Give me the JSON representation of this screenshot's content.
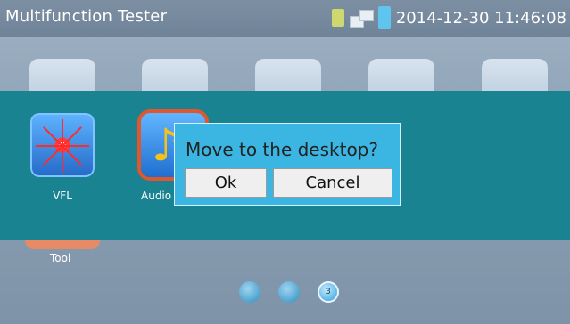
{
  "header": {
    "title": "Multifunction Tester",
    "datetime": "2014-12-30 11:46:08",
    "icons": [
      "sd-card-icon",
      "network-icon",
      "battery-icon"
    ]
  },
  "apps": {
    "vfl": {
      "label": "VFL"
    },
    "audio": {
      "label": "Audio"
    },
    "tool": {
      "label": "Tool"
    }
  },
  "dialog": {
    "message": "Move to the desktop?",
    "ok_label": "Ok",
    "cancel_label": "Cancel"
  },
  "pager": {
    "active_page": "3"
  },
  "colors": {
    "panel": "#1a8391",
    "dialog_bg": "#3bb6e2",
    "highlight": "#e0562d"
  }
}
